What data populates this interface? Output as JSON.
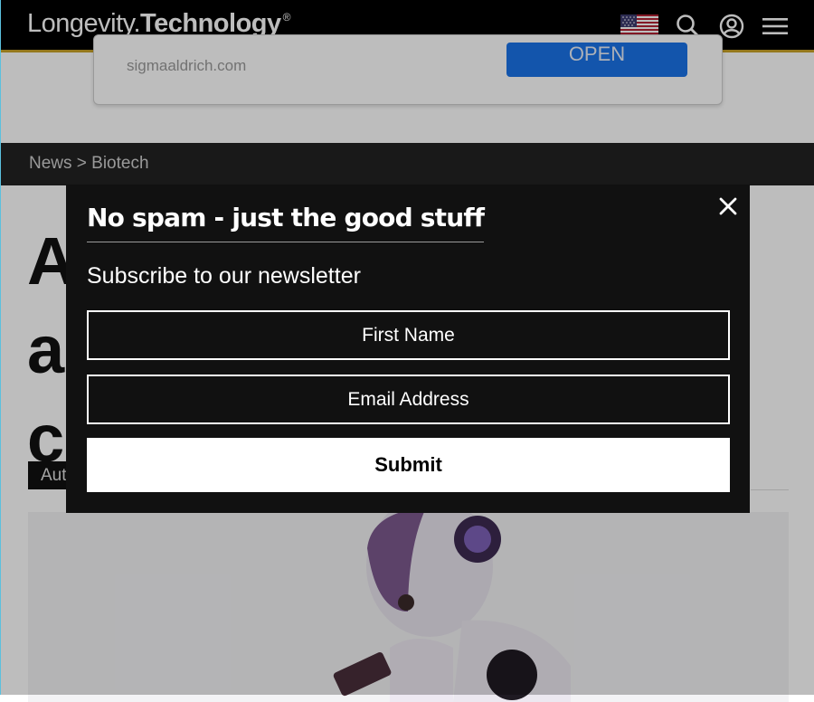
{
  "header": {
    "logo_light": "Longevity.",
    "logo_bold": "Technology",
    "logo_mark": "®",
    "icons": [
      "us-flag-icon",
      "search-icon",
      "account-icon",
      "menu-icon"
    ]
  },
  "ad": {
    "domain": "sigmaaldrich.com",
    "button_label": "OPEN"
  },
  "breadcrumb": {
    "text": "News > Biotech"
  },
  "article": {
    "headline_lines": [
      "A",
      "a",
      "c"
    ],
    "author_label": "Aut"
  },
  "newsletter": {
    "title": "No spam - just the good stuff",
    "subtitle": "Subscribe to our newsletter",
    "first_name_placeholder": "First Name",
    "email_placeholder": "Email Address",
    "submit_label": "Submit",
    "close_icon": "close-icon"
  },
  "colors": {
    "header_bg": "#000000",
    "header_accent": "#c9a227",
    "modal_bg": "#111111",
    "ad_button": "#1a73e8"
  }
}
